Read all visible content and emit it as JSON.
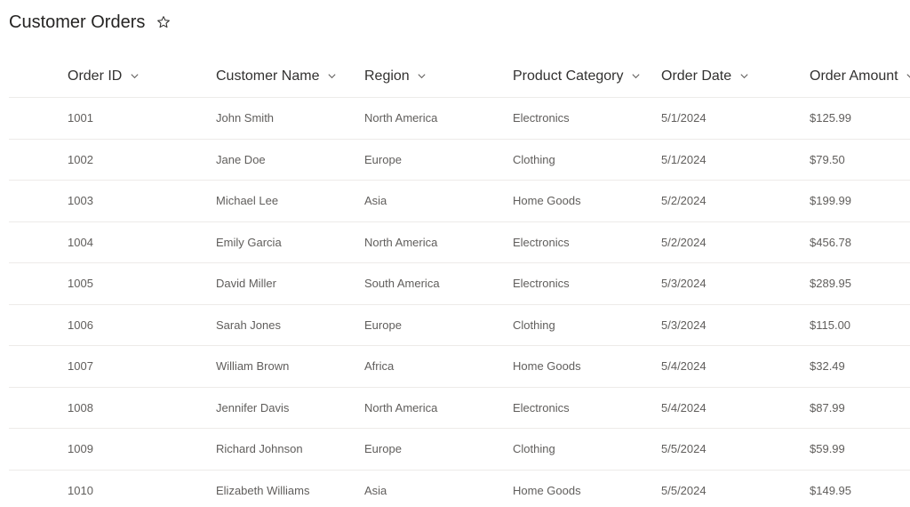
{
  "page": {
    "title": "Customer Orders"
  },
  "columns": [
    {
      "key": "order_id",
      "label": "Order ID"
    },
    {
      "key": "customer_name",
      "label": "Customer Name"
    },
    {
      "key": "region",
      "label": "Region"
    },
    {
      "key": "product_category",
      "label": "Product Category"
    },
    {
      "key": "order_date",
      "label": "Order Date"
    },
    {
      "key": "order_amount",
      "label": "Order Amount"
    }
  ],
  "rows": [
    [
      "1001",
      "John Smith",
      "North America",
      "Electronics",
      "5/1/2024",
      "$125.99"
    ],
    [
      "1002",
      "Jane Doe",
      "Europe",
      "Clothing",
      "5/1/2024",
      "$79.50"
    ],
    [
      "1003",
      "Michael Lee",
      "Asia",
      "Home Goods",
      "5/2/2024",
      "$199.99"
    ],
    [
      "1004",
      "Emily Garcia",
      "North America",
      "Electronics",
      "5/2/2024",
      "$456.78"
    ],
    [
      "1005",
      "David Miller",
      "South America",
      "Electronics",
      "5/3/2024",
      "$289.95"
    ],
    [
      "1006",
      "Sarah Jones",
      "Europe",
      "Clothing",
      "5/3/2024",
      "$115.00"
    ],
    [
      "1007",
      "William Brown",
      "Africa",
      "Home Goods",
      "5/4/2024",
      "$32.49"
    ],
    [
      "1008",
      "Jennifer Davis",
      "North America",
      "Electronics",
      "5/4/2024",
      "$87.99"
    ],
    [
      "1009",
      "Richard Johnson",
      "Europe",
      "Clothing",
      "5/5/2024",
      "$59.99"
    ],
    [
      "1010",
      "Elizabeth Williams",
      "Asia",
      "Home Goods",
      "5/5/2024",
      "$149.95"
    ]
  ],
  "icons": {
    "favorite": "star-outline-icon",
    "sort": "chevron-down-icon"
  },
  "colors": {
    "title": "#252423",
    "header_text": "#323130",
    "cell_text": "#605e5c",
    "divider": "#edebe9"
  }
}
